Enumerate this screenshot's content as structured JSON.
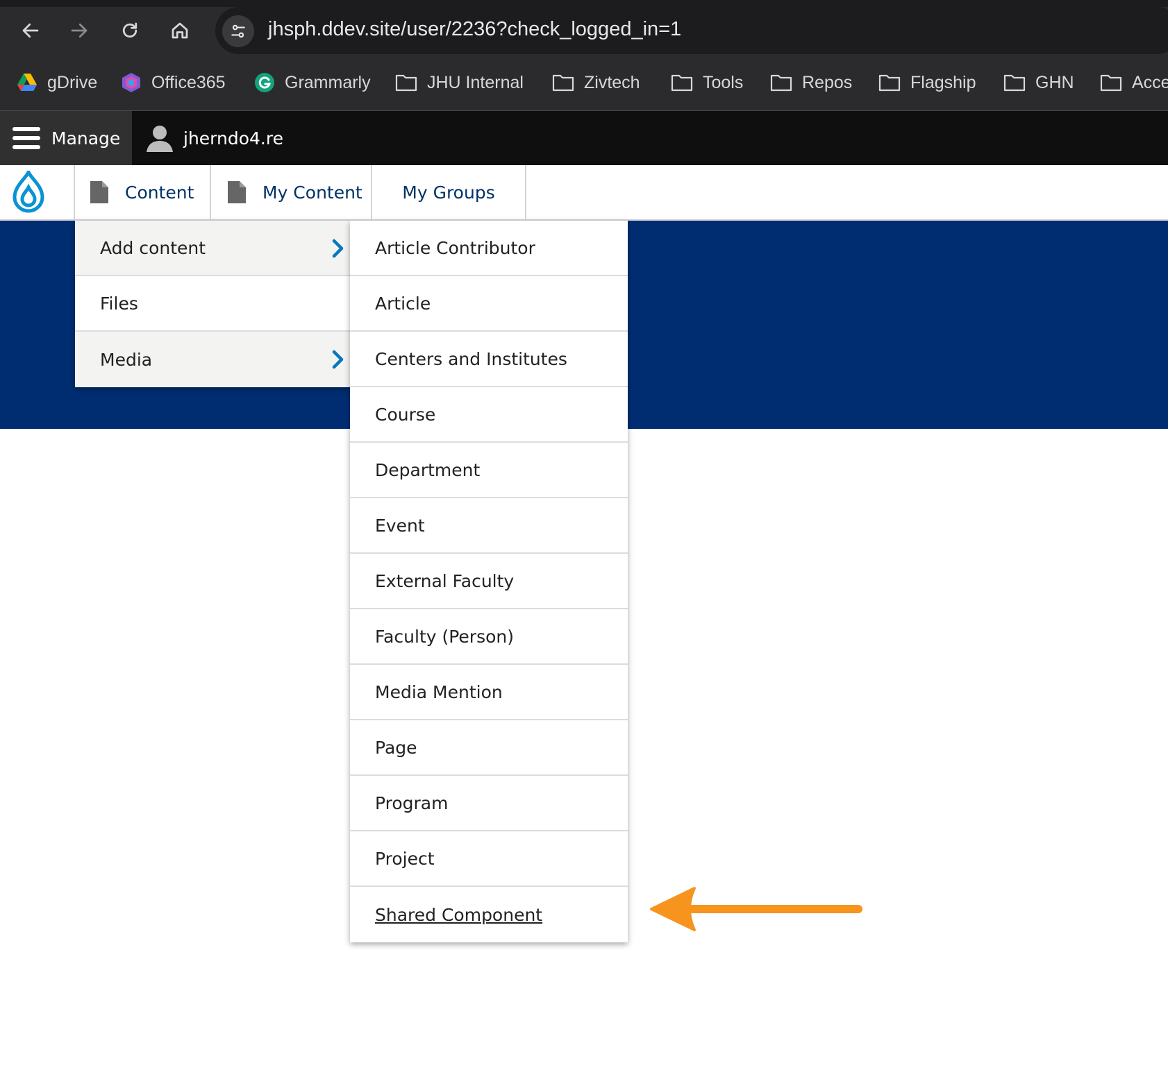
{
  "browser": {
    "url": "jhsph.ddev.site/user/2236?check_logged_in=1",
    "bookmarks": [
      {
        "label": "gDrive",
        "icon": "google-drive-icon"
      },
      {
        "label": "Office365",
        "icon": "office365-icon"
      },
      {
        "label": "Grammarly",
        "icon": "grammarly-icon"
      },
      {
        "label": "JHU Internal",
        "icon": "folder-icon"
      },
      {
        "label": "Zivtech",
        "icon": "folder-icon"
      },
      {
        "label": "Tools",
        "icon": "folder-icon"
      },
      {
        "label": "Repos",
        "icon": "folder-icon"
      },
      {
        "label": "Flagship",
        "icon": "folder-icon"
      },
      {
        "label": "GHN",
        "icon": "folder-icon"
      },
      {
        "label": "Acce",
        "icon": "folder-icon"
      }
    ]
  },
  "toolbar": {
    "manage_label": "Manage",
    "user_label": "jherndo4.re"
  },
  "tray": {
    "items": [
      {
        "label": "Content",
        "icon": "file-icon"
      },
      {
        "label": "My Content",
        "icon": "file-icon"
      },
      {
        "label": "My Groups"
      }
    ]
  },
  "content_menu": [
    {
      "label": "Add content",
      "has_submenu": true
    },
    {
      "label": "Files",
      "has_submenu": false
    },
    {
      "label": "Media",
      "has_submenu": true
    }
  ],
  "add_content_menu": [
    "Article Contributor",
    "Article",
    "Centers and Institutes",
    "Course",
    "Department",
    "Event",
    "External Faculty",
    "Faculty (Person)",
    "Media Mention",
    "Page",
    "Program",
    "Project",
    "Shared Component"
  ],
  "colors": {
    "hero": "#002d72",
    "link": "#003366",
    "chevron": "#0678be",
    "annotation_arrow": "#f7941d"
  }
}
